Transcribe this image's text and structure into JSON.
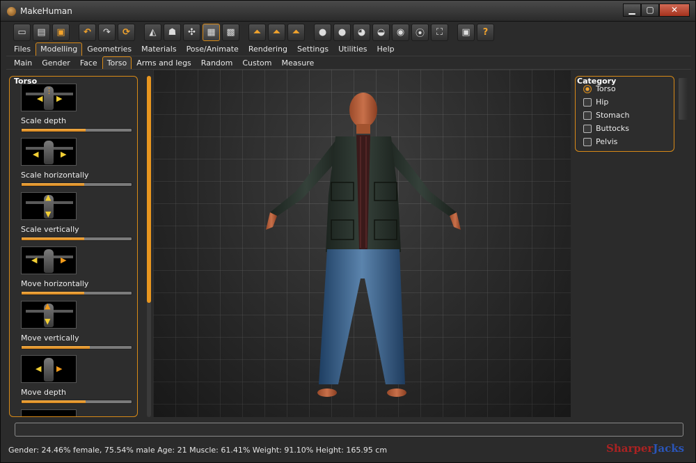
{
  "window": {
    "title": "MakeHuman"
  },
  "toolbar": {
    "groups": [
      [
        "new-icon",
        "save-icon",
        "export-icon"
      ],
      [
        "undo-icon",
        "redo-icon",
        "reset-icon"
      ],
      [
        "smooth-icon",
        "wireframe-icon",
        "pose-icon",
        "grid-icon",
        "checker-icon"
      ],
      [
        "front-view-icon",
        "side-view-icon",
        "top-view-icon"
      ],
      [
        "view1-icon",
        "view2-icon",
        "view3-icon",
        "view4-icon",
        "view5-icon",
        "view6-icon",
        "frame-icon"
      ],
      [
        "screenshot-icon",
        "help-icon"
      ]
    ],
    "help_glyph": "?"
  },
  "main_tabs": [
    "Files",
    "Modelling",
    "Geometries",
    "Materials",
    "Pose/Animate",
    "Rendering",
    "Settings",
    "Utilities",
    "Help"
  ],
  "main_tab_active": "Modelling",
  "sub_tabs": [
    "Main",
    "Gender",
    "Face",
    "Torso",
    "Arms and legs",
    "Random",
    "Custom",
    "Measure"
  ],
  "sub_tab_active": "Torso",
  "left_panel": {
    "title": "Torso",
    "sliders": [
      {
        "label": "Scale depth",
        "value": 0.58
      },
      {
        "label": "Scale horizontally",
        "value": 0.57
      },
      {
        "label": "Scale vertically",
        "value": 0.57
      },
      {
        "label": "Move horizontally",
        "value": 0.57
      },
      {
        "label": "Move vertically",
        "value": 0.62
      },
      {
        "label": "Move depth",
        "value": 0.58
      }
    ]
  },
  "right_panel": {
    "title": "Category",
    "options": [
      "Torso",
      "Hip",
      "Stomach",
      "Buttocks",
      "Pelvis"
    ],
    "selected": "Torso"
  },
  "status": {
    "text": "Gender: 24.46% female, 75.54% male Age: 21 Muscle: 61.41% Weight: 91.10% Height: 165.95 cm"
  },
  "watermark": {
    "part1": "Sharper",
    "part2": "Jacks"
  },
  "colors": {
    "accent": "#d98a17",
    "slider_fill": "#f2a32c",
    "background": "#2b2b2b"
  }
}
